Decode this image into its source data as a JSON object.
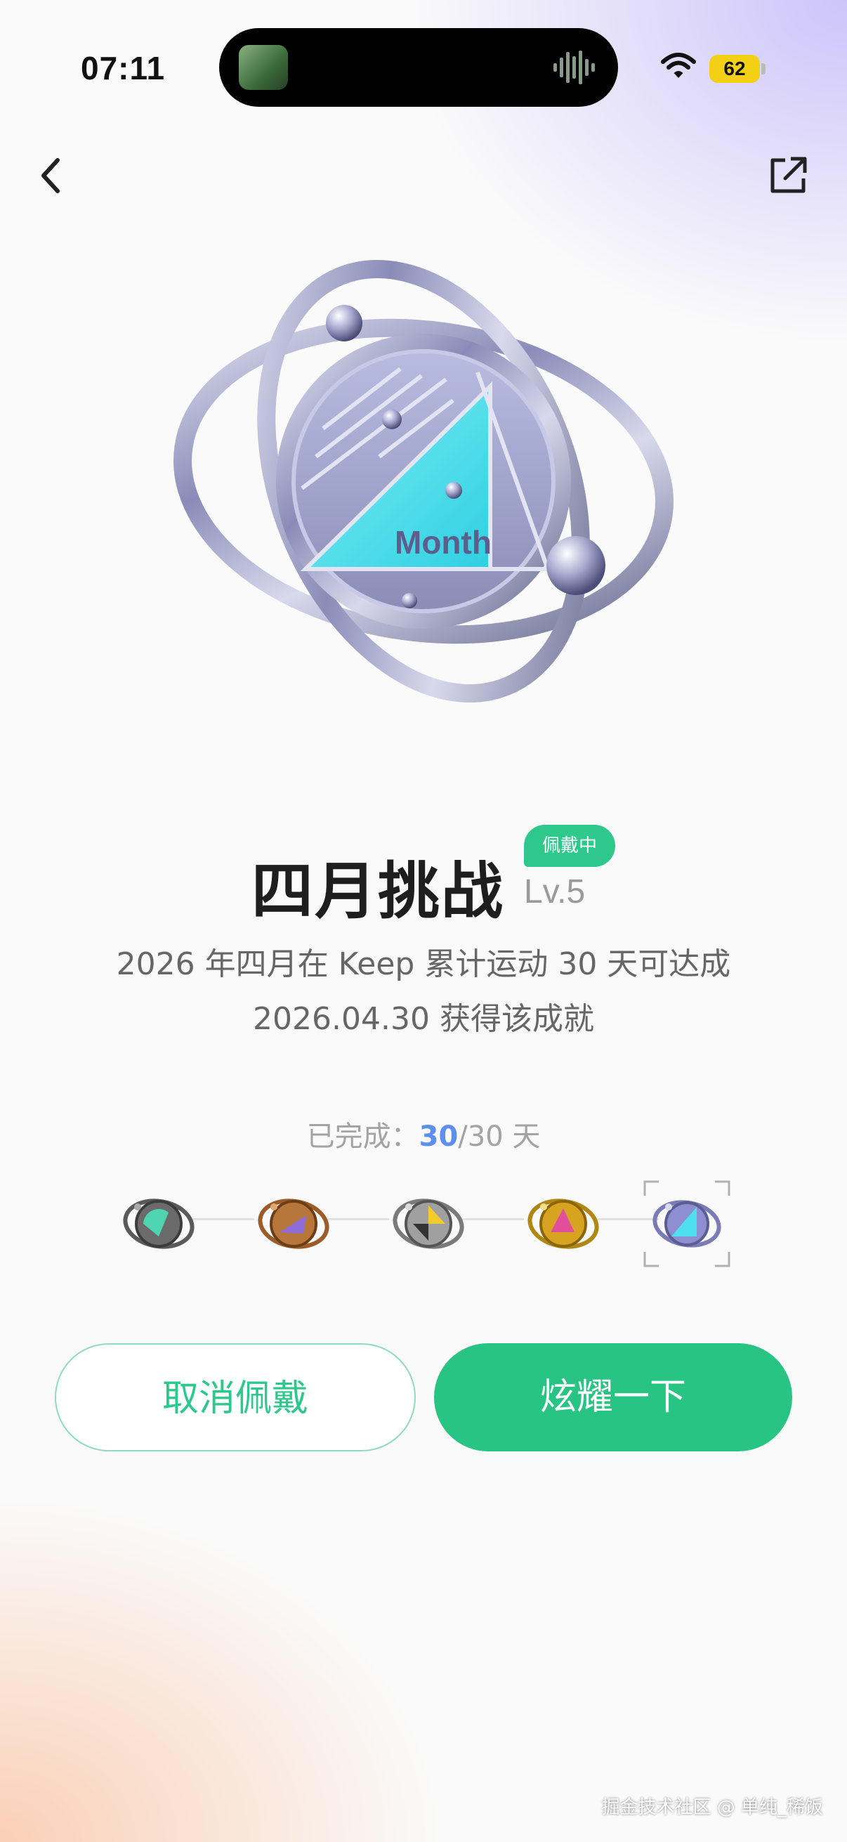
{
  "status_bar": {
    "time": "07:11",
    "battery": "62",
    "battery_color": "#f3cf16"
  },
  "nav": {
    "back_icon": "chevron-left-icon",
    "share_icon": "share-external-icon"
  },
  "medal": {
    "art_text": "Month",
    "accent": "#4fe0ee"
  },
  "achievement": {
    "title": "四月挑战",
    "level": "Lv.5",
    "badge": "佩戴中",
    "description_line1": "2026 年四月在 Keep 累计运动 30 天可达成",
    "description_line2": "2026.04.30 获得该成就"
  },
  "progress": {
    "label": "已完成：",
    "done": "30",
    "total": "/30 天",
    "level_fill": 1.0
  },
  "levels": [
    {
      "name": "level-1",
      "color": "#4ed4b0"
    },
    {
      "name": "level-2",
      "color": "#b8773a"
    },
    {
      "name": "level-3",
      "color": "#9a9a9a"
    },
    {
      "name": "level-4",
      "color": "#d6a420"
    },
    {
      "name": "level-5",
      "color": "#8e8fd2",
      "selected": true
    }
  ],
  "buttons": {
    "cancel": "取消佩戴",
    "show": "炫耀一下"
  },
  "watermark": "掘金技术社区 @ 单纯_稀饭",
  "colors": {
    "brand_green": "#27c484",
    "progress_blue": "#5b8ff0"
  }
}
